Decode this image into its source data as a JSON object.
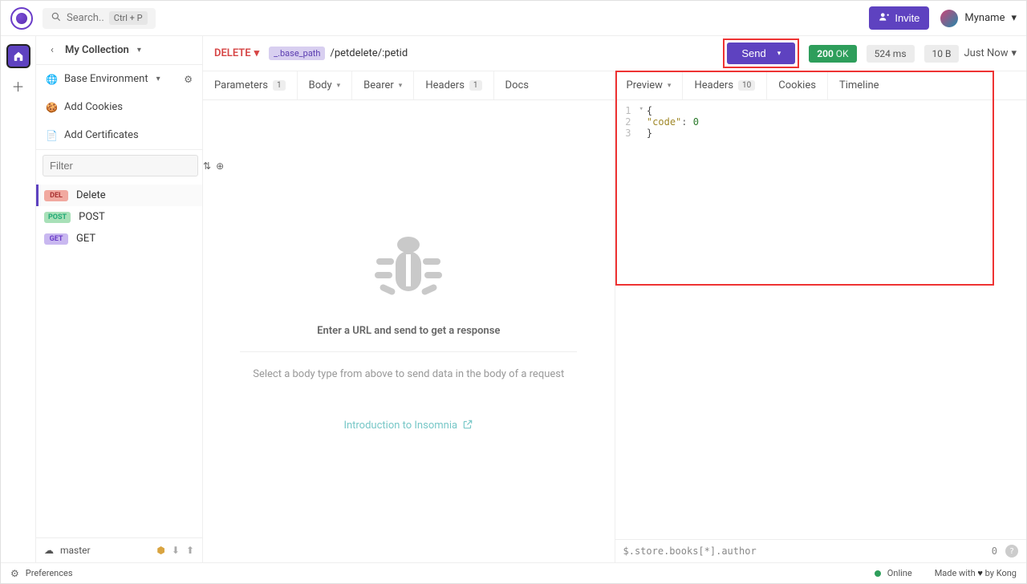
{
  "topbar": {
    "search_placeholder": "Search..",
    "search_shortcut": "Ctrl + P",
    "invite_label": "Invite",
    "username": "Myname"
  },
  "sidebar": {
    "collection_title": "My Collection",
    "env_label": "Base Environment",
    "cookies_label": "Add Cookies",
    "certs_label": "Add Certificates",
    "filter_placeholder": "Filter",
    "requests": [
      {
        "method": "DEL",
        "label": "Delete",
        "cls": "m-del",
        "active": true
      },
      {
        "method": "POST",
        "label": "POST",
        "cls": "m-post",
        "active": false
      },
      {
        "method": "GET",
        "label": "GET",
        "cls": "m-get",
        "active": false
      }
    ],
    "branch": "master"
  },
  "request": {
    "method": "DELETE",
    "url_chip": "_.base_path",
    "url_rest": "/petdelete/:petid",
    "send_label": "Send",
    "status_code": "200",
    "status_text": "OK",
    "time": "524 ms",
    "size": "10 B",
    "timestamp": "Just Now",
    "tabs": {
      "parameters": "Parameters",
      "parameters_count": "1",
      "body": "Body",
      "bearer": "Bearer",
      "headers": "Headers",
      "headers_count": "1",
      "docs": "Docs"
    }
  },
  "response": {
    "tabs": {
      "preview": "Preview",
      "headers": "Headers",
      "headers_count": "10",
      "cookies": "Cookies",
      "timeline": "Timeline"
    },
    "body_lines": [
      {
        "n": "1",
        "text_pre": "{",
        "key": "",
        "val": ""
      },
      {
        "n": "2",
        "text_pre": "   ",
        "key": "\"code\"",
        "punc": ": ",
        "val": "0"
      },
      {
        "n": "3",
        "text_pre": "}",
        "key": "",
        "val": ""
      }
    ],
    "jsonpath": "$.store.books[*].author",
    "result_count": "0"
  },
  "empty": {
    "title": "Enter a URL and send to get a response",
    "subtitle": "Select a body type from above to send data in the body of a request",
    "intro": "Introduction to Insomnia"
  },
  "status": {
    "preferences": "Preferences",
    "online": "Online",
    "made_pre": "Made with",
    "made_post": "by Kong"
  }
}
